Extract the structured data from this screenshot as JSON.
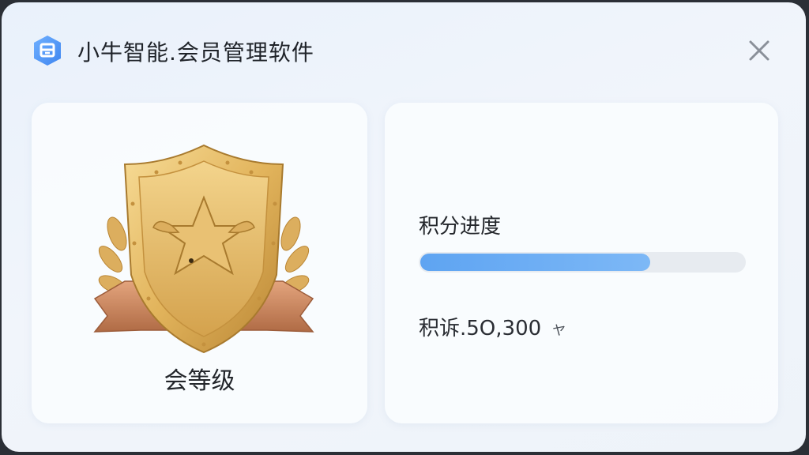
{
  "window": {
    "title": "小牛智能.会员管理软件",
    "logo_icon": "app-logo-icon",
    "close_icon": "close-icon"
  },
  "level_card": {
    "badge_icon": "gold-shield-bull-badge-icon",
    "level_label": "会等级"
  },
  "points_card": {
    "progress_label": "积分进度",
    "progress_fraction": 0.71,
    "points_text": "积诉.5O,300",
    "points_unit": "ヤ"
  },
  "colors": {
    "accent_blue": "#5ea4f2",
    "badge_gold": "#e1b35b",
    "ribbon_bronze": "#c98357"
  }
}
